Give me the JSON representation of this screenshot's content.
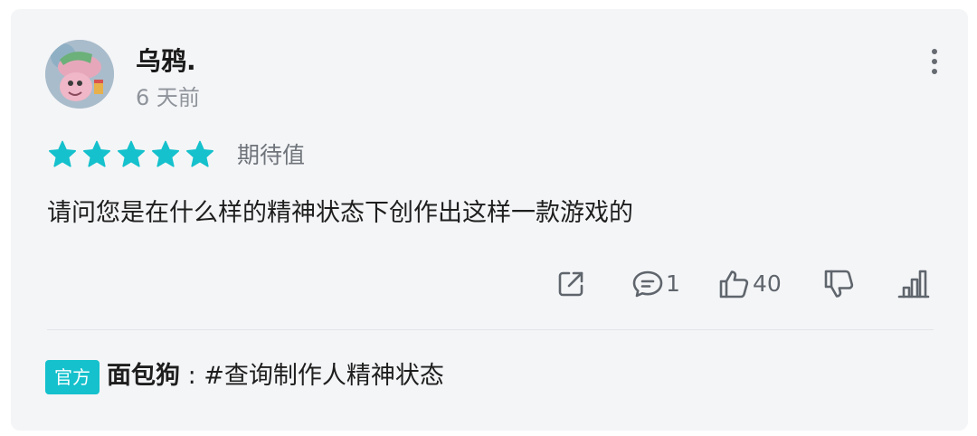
{
  "review": {
    "username": "乌鸦.",
    "time_ago": "6 天前",
    "rating_stars": 5,
    "rating_max": 5,
    "rating_label": "期待值",
    "text": "请问您是在什么样的精神状态下创作出这样一款游戏的"
  },
  "actions": {
    "comment_count": "1",
    "like_count": "40"
  },
  "reply": {
    "badge": "官方",
    "author": "面包狗",
    "separator": " : ",
    "text": "#查询制作人精神状态"
  },
  "colors": {
    "star": "#14c1cc",
    "badge_bg": "#14c1cc",
    "card_bg": "#f4f5f7"
  },
  "icons": {
    "more": "more-vertical-icon",
    "share": "share-icon",
    "comment": "comment-icon",
    "like": "thumbs-up-icon",
    "dislike": "thumbs-down-icon",
    "stats": "bar-chart-icon"
  }
}
